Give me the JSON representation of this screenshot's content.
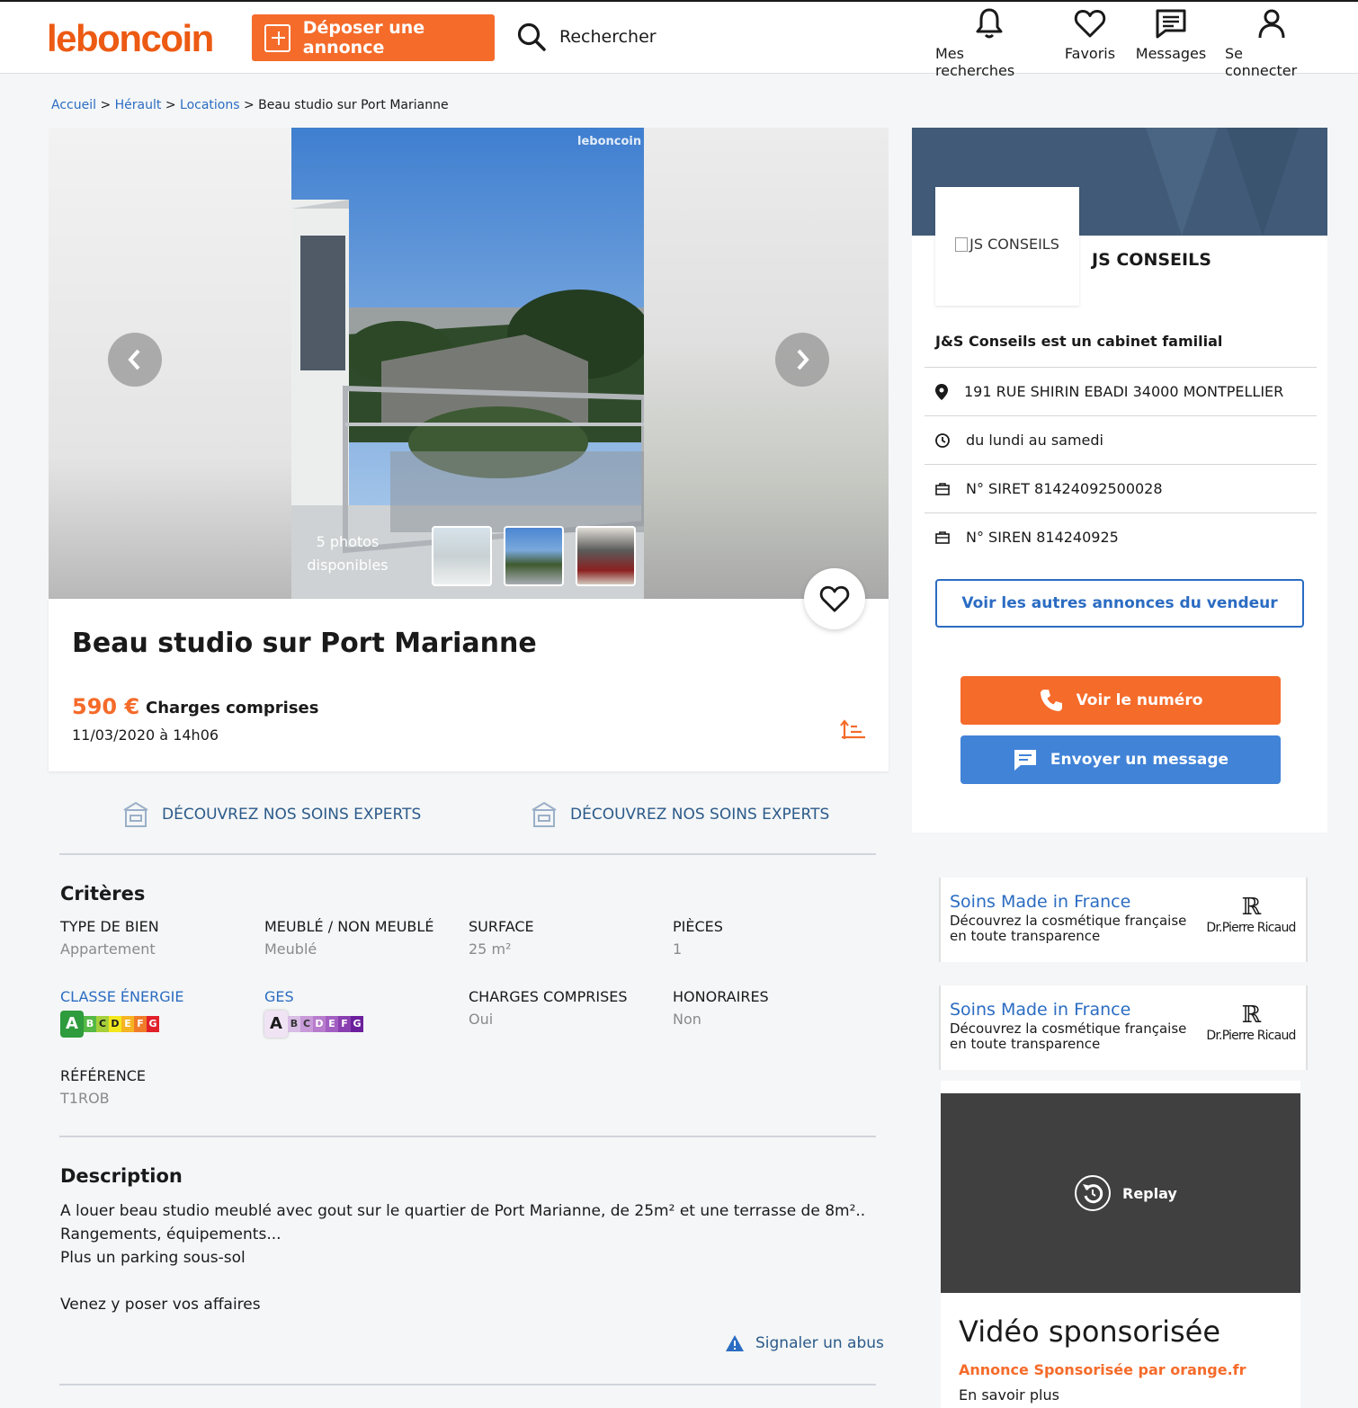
{
  "header": {
    "logo": "leboncoin",
    "post_ad": "Déposer une annonce",
    "search": "Rechercher",
    "nav": [
      {
        "label": "Mes recherches",
        "icon": "bell-icon"
      },
      {
        "label": "Favoris",
        "icon": "heart-icon"
      },
      {
        "label": "Messages",
        "icon": "message-icon"
      },
      {
        "label": "Se connecter",
        "icon": "user-icon"
      }
    ]
  },
  "breadcrumb": {
    "items": [
      "Accueil",
      "Hérault",
      "Locations"
    ],
    "current": "Beau studio sur Port Marianne",
    "sep": " > "
  },
  "gallery": {
    "watermark": "leboncoin",
    "photos_count": "5 photos disponibles",
    "thumbnails": 3
  },
  "ad": {
    "title": "Beau studio sur Port Marianne",
    "price": "590 €",
    "charges": "Charges comprises",
    "date": "11/03/2020 à 14h06"
  },
  "promos": [
    "DÉCOUVREZ NOS SOINS EXPERTS",
    "DÉCOUVREZ NOS SOINS EXPERTS"
  ],
  "criteria": {
    "title": "Critères",
    "items": [
      {
        "label": "Type de bien",
        "value": "Appartement"
      },
      {
        "label": "Meublé / Non meublé",
        "value": "Meublé"
      },
      {
        "label": "Surface",
        "value": "25 m²"
      },
      {
        "label": "Pièces",
        "value": "1"
      },
      {
        "label": "Classe énergie",
        "value": "A"
      },
      {
        "label": "GES",
        "value": "A"
      },
      {
        "label": "Charges comprises",
        "value": "Oui"
      },
      {
        "label": "Honoraires",
        "value": "Non"
      },
      {
        "label": "Référence",
        "value": "T1ROB"
      }
    ],
    "energy_scale": [
      "A",
      "B",
      "C",
      "D",
      "E",
      "F",
      "G"
    ],
    "energy_colors": [
      "#2e9b3c",
      "#56b947",
      "#a6cf3a",
      "#f4e81c",
      "#f6b422",
      "#f07b28",
      "#e1202a"
    ],
    "ges_colors": [
      "#f0e4f4",
      "#d8bde5",
      "#c89ad9",
      "#b87ccd",
      "#a25fc1",
      "#8a3fb0",
      "#6c1f9c"
    ]
  },
  "description": {
    "title": "Description",
    "lines": [
      "A louer beau studio meublé avec gout sur le quartier de Port Marianne, de 25m² et une terrasse de 8m²..",
      "Rangements, équipements...",
      "Plus un parking sous-sol",
      "",
      "Venez y poser vos affaires"
    ],
    "report": "Signaler un abus"
  },
  "seller": {
    "logo_alt": "JS CONSEILS",
    "name": "JS CONSEILS",
    "description": "J&S Conseils est un cabinet familial",
    "address": "191 RUE SHIRIN EBADI 34000 MONTPELLIER",
    "hours": "du lundi au samedi",
    "siret": "N° SIRET 81424092500028",
    "siren": "N° SIREN 814240925",
    "other_ads": "Voir les autres annonces du vendeur",
    "show_number": "Voir le numéro",
    "send_message": "Envoyer un message"
  },
  "sponsored": [
    {
      "title": "Soins Made in France",
      "text": "Découvrez la cosmétique française en toute transparence",
      "brand": "Dr.Pierre Ricaud"
    },
    {
      "title": "Soins Made in France",
      "text": "Découvrez la cosmétique française en toute transparence",
      "brand": "Dr.Pierre Ricaud"
    }
  ],
  "video": {
    "replay": "Replay",
    "title": "Vidéo sponsorisée",
    "sponsor": "Annonce Sponsorisée par orange.fr",
    "more": "En savoir plus"
  },
  "colors": {
    "brand": "#ec5a13",
    "accent": "#f56b2a",
    "link": "#2b6cc2",
    "button_blue": "#4183d7"
  }
}
